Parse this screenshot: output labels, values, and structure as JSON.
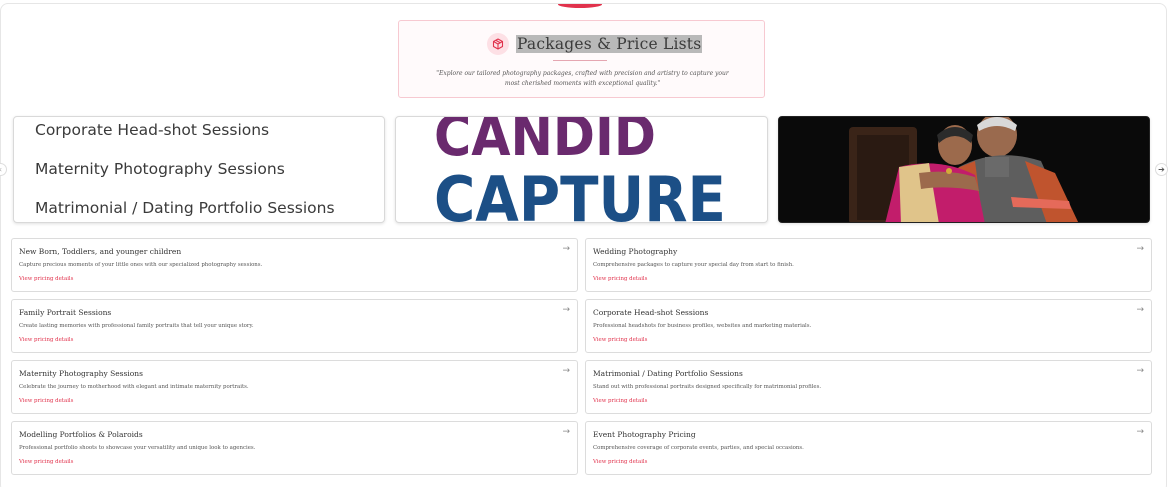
{
  "header": {
    "icon": "package-icon",
    "title": "Packages & Price Lists",
    "description": "\"Explore our tailored photography packages, crafted with precision and artistry to capture your most cherished moments with exceptional quality.\""
  },
  "carousel": {
    "prev_icon": "chevron-left-icon",
    "next_icon": "chevron-right-icon",
    "list_items": [
      "Corporate Head-shot Sessions",
      "Maternity Photography Sessions",
      "Matrimonial / Dating Portfolio Sessions"
    ],
    "logo": {
      "line1": "CANDID",
      "line2": "CAPTURE",
      "colors": {
        "line1": "#6a2a6e",
        "line2": "#1c4f86"
      }
    },
    "photo": {
      "subject": "elderly-couple-photo"
    }
  },
  "packages": [
    {
      "title": "New Born, Toddlers, and younger children",
      "description": "Capture precious moments of your little ones with our specialized photography sessions.",
      "link": "View pricing details"
    },
    {
      "title": "Wedding Photography",
      "description": "Comprehensive packages to capture your special day from start to finish.",
      "link": "View pricing details"
    },
    {
      "title": "Family Portrait Sessions",
      "description": "Create lasting memories with professional family portraits that tell your unique story.",
      "link": "View pricing details"
    },
    {
      "title": "Corporate Head-shot Sessions",
      "description": "Professional headshots for business profiles, websites and marketing materials.",
      "link": "View pricing details"
    },
    {
      "title": "Maternity Photography Sessions",
      "description": "Celebrate the journey to motherhood with elegant and intimate maternity portraits.",
      "link": "View pricing details"
    },
    {
      "title": "Matrimonial / Dating Portfolio Sessions",
      "description": "Stand out with professional portraits designed specifically for matrimonial profiles.",
      "link": "View pricing details"
    },
    {
      "title": "Modelling Portfolios & Polaroids",
      "description": "Professional portfolio shoots to showcase your versatility and unique look to agencies.",
      "link": "View pricing details"
    },
    {
      "title": "Event Photography Pricing",
      "description": "Comprehensive coverage of corporate events, parties, and special occasions.",
      "link": "View pricing details"
    }
  ],
  "colors": {
    "accent": "#e1324c",
    "header_bg": "#fffafb",
    "header_border": "#f7c9d1"
  }
}
